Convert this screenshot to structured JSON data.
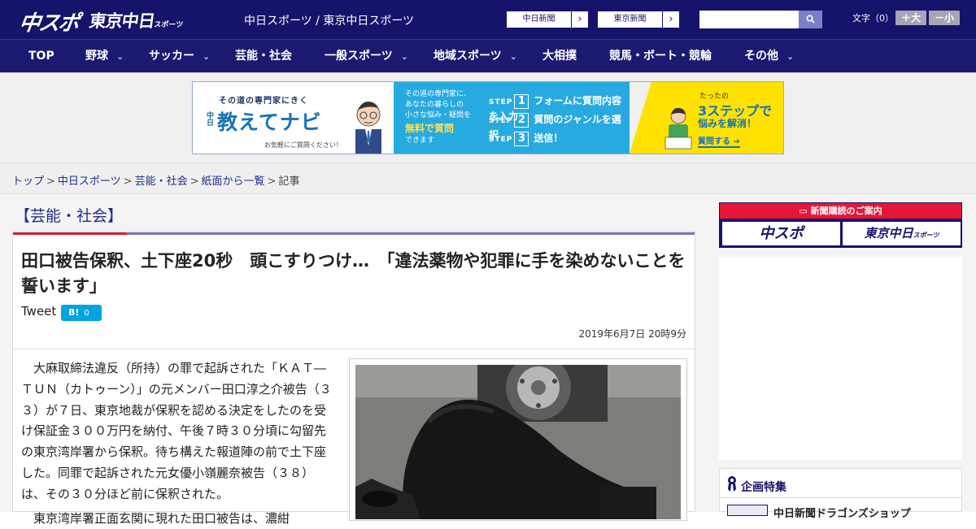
{
  "header": {
    "logo_chusupo": "中スポ",
    "logo_tokyo": "東京中日",
    "logo_tokyo_sub": "スポーツ",
    "site_title": "中日スポーツ / 東京中日スポーツ",
    "btn_chunichi": "中日新聞",
    "btn_tokyo": "東京新聞",
    "btn_arrow": "›",
    "search_icon": "magnifier-icon",
    "font_label": "文字（0）",
    "font_plus": "＋大",
    "font_minus": "－小",
    "bg_color": "#16136b"
  },
  "nav": {
    "items": [
      {
        "label": "TOP",
        "chev": ""
      },
      {
        "label": "野球",
        "chev": "⌄"
      },
      {
        "label": "サッカー",
        "chev": "⌄"
      },
      {
        "label": "芸能・社会",
        "chev": ""
      },
      {
        "label": "一般スポーツ",
        "chev": "⌄"
      },
      {
        "label": "地域スポーツ",
        "chev": "⌄"
      },
      {
        "label": "大相撲",
        "chev": ""
      },
      {
        "label": "競馬・ボート・競輪",
        "chev": ""
      },
      {
        "label": "その他",
        "chev": "⌄"
      }
    ]
  },
  "banner": {
    "tagline": "その道の専門家にきく",
    "vertical": "中日",
    "brand": "教えてナビ",
    "note": "お気軽にご質問ください！",
    "mid_line1": "その道の専門家に、",
    "mid_line2": "あなたの暮らしの",
    "mid_line3": "小さな悩み・疑問を",
    "mid_free": "無料で質問",
    "mid_line4": "できます",
    "step_word": "STEP",
    "steps": [
      {
        "num": "1",
        "text": "フォームに質問内容を入力"
      },
      {
        "num": "2",
        "text": "質問のジャンルを選択"
      },
      {
        "num": "3",
        "text": "送信！"
      }
    ],
    "r1": "たったの",
    "r2": "3ステップで",
    "r3": "悩みを解消！",
    "r4": "質問する ➔"
  },
  "breadcrumb": {
    "items": [
      "トップ",
      "中日スポーツ",
      "芸能・社会",
      "紙面から一覧"
    ],
    "current": "記事",
    "sep": ">"
  },
  "article": {
    "category": "【芸能・社会】",
    "title": "田口被告保釈、土下座20秒　頭こすりつけ…　「違法薬物や犯罪に手を染めないことを誓います」",
    "tweet": "Tweet",
    "hatena_label": "B!",
    "hatena_count": "0",
    "date": "2019年6月7日 20時9分",
    "body": "大麻取締法違反（所持）の罪で起訴された「ＫＡＴ―ＴＵＮ（カトゥーン）」の元メンバー田口淳之介被告（３３）が７日、東京地裁が保釈を認める決定をしたのを受け保証金３００万円を納付、午後７時３０分頃に勾留先の東京湾岸署から保釈。待ち構えた報道陣の前で土下座した。同罪で起訴された元女優小嶺麗奈被告（３８）は、その３０分ほど前に保釈された。",
    "body2": "東京湾岸署正面玄関に現れた田口被告は、濃紺"
  },
  "sidebar": {
    "subscribe_label": "新聞購読のご案内",
    "logo1": "中スポ",
    "logo2": "東京中日",
    "logo2_sub": "スポーツ",
    "feature_label": "企画特集",
    "feature_item": "中日新聞ドラゴンズショップ"
  }
}
